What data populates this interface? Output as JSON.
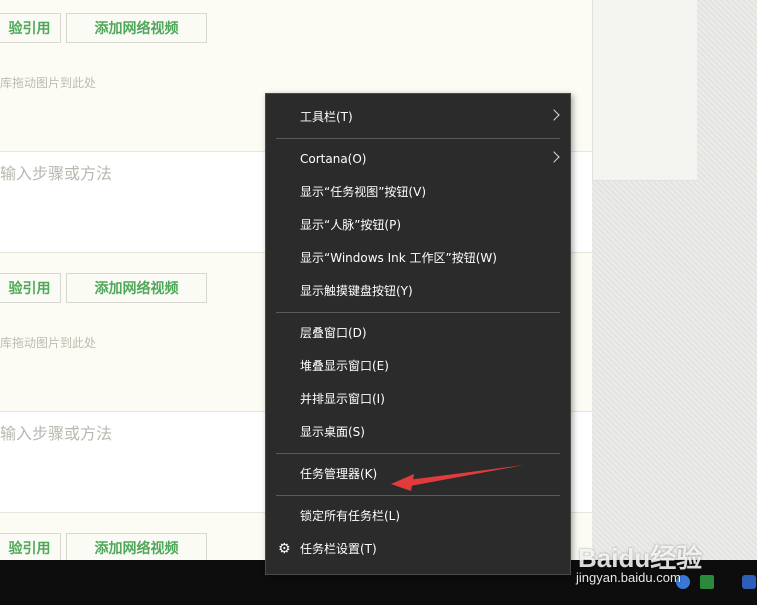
{
  "editor": {
    "buttons": [
      {
        "ref_label": "验引用",
        "video_label": "添加网络视频"
      },
      {
        "ref_label": "验引用",
        "video_label": "添加网络视频"
      },
      {
        "ref_label": "验引用",
        "video_label": "添加网络视频"
      }
    ],
    "drag_hint": "库拖动图片到此处",
    "step_placeholder": "输入步骤或方法"
  },
  "context_menu": {
    "items": [
      {
        "label": "工具栏(T)",
        "submenu": true
      },
      {
        "label": "Cortana(O)",
        "submenu": true
      },
      {
        "label": "显示“任务视图”按钮(V)"
      },
      {
        "label": "显示“人脉”按钮(P)"
      },
      {
        "label": "显示“Windows Ink 工作区”按钮(W)"
      },
      {
        "label": "显示触摸键盘按钮(Y)"
      },
      {
        "label": "层叠窗口(D)"
      },
      {
        "label": "堆叠显示窗口(E)"
      },
      {
        "label": "并排显示窗口(I)"
      },
      {
        "label": "显示桌面(S)"
      },
      {
        "label": "任务管理器(K)",
        "highlighted_by_arrow": true
      },
      {
        "label": "锁定所有任务栏(L)"
      },
      {
        "label": "任务栏设置(T)",
        "icon": "gear-icon"
      }
    ]
  },
  "watermark": {
    "brand": "Baidu经验",
    "url": "jingyan.baidu.com"
  },
  "colors": {
    "menu_bg": "#2b2b2b",
    "editor_bg": "#fcfcf4",
    "button_text": "#4fa85a",
    "arrow": "#e23b3b"
  }
}
